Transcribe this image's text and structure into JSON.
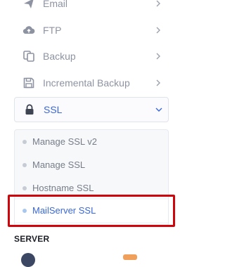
{
  "sidebar": {
    "items": [
      {
        "label": "Email",
        "icon": "send-icon"
      },
      {
        "label": "FTP",
        "icon": "cloud-upload-icon"
      },
      {
        "label": "Backup",
        "icon": "copy-icon"
      },
      {
        "label": "Incremental Backup",
        "icon": "save-icon"
      },
      {
        "label": "SSL",
        "icon": "lock-icon",
        "expanded": true
      }
    ],
    "ssl_submenu": [
      {
        "label": "Manage SSL v2"
      },
      {
        "label": "Manage SSL"
      },
      {
        "label": "Hostname SSL"
      },
      {
        "label": "MailServer SSL",
        "active": true
      }
    ]
  },
  "section": {
    "title": "SERVER"
  },
  "colors": {
    "accent": "#3a67d8",
    "highlight_border": "#d0050b",
    "muted_text": "#8d93a1"
  }
}
